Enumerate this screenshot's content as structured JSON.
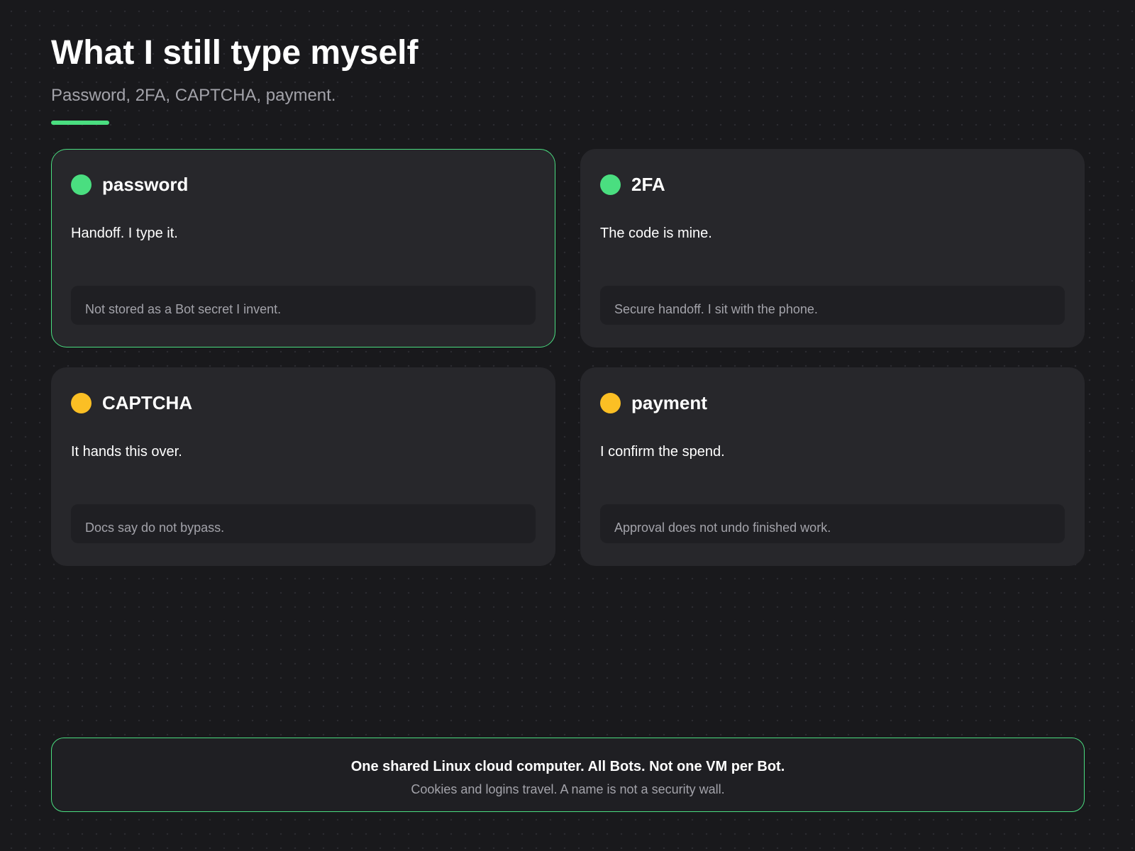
{
  "header": {
    "title": "What I still type myself",
    "subtitle": "Password, 2FA, CAPTCHA, payment."
  },
  "colors": {
    "background": "#19191c",
    "card": "#27272b",
    "note": "#1f1f23",
    "accent_green": "#4ade80",
    "accent_yellow": "#fbbf24",
    "muted_text": "#a3a3aa"
  },
  "cards": [
    {
      "title": "password",
      "body": "Handoff. I type it.",
      "note": "Not stored as a Bot secret I invent.",
      "status_color": "#4ade80",
      "highlighted": true
    },
    {
      "title": "2FA",
      "body": "The code is mine.",
      "note": "Secure handoff. I sit with the phone.",
      "status_color": "#4ade80",
      "highlighted": false
    },
    {
      "title": "CAPTCHA",
      "body": "It hands this over.",
      "note": "Docs say do not bypass.",
      "status_color": "#fbbf24",
      "highlighted": false
    },
    {
      "title": "payment",
      "body": "I confirm the spend.",
      "note": "Approval does not undo finished work.",
      "status_color": "#fbbf24",
      "highlighted": false
    }
  ],
  "footer": {
    "main": "One shared Linux cloud computer. All Bots. Not one VM per Bot.",
    "sub": "Cookies and logins travel. A name is not a security wall."
  }
}
